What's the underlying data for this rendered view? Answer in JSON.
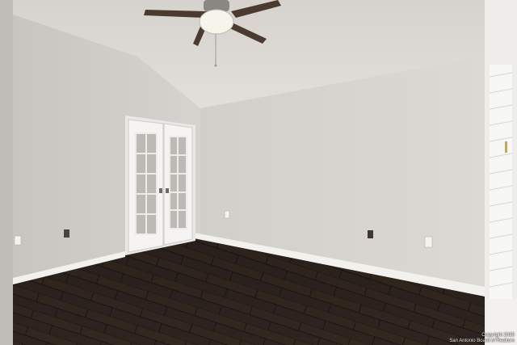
{
  "scene": {
    "kind": "photo",
    "room": "empty bedroom",
    "features": [
      "ceiling-fan",
      "french-doors",
      "dark-wood-plank-floor",
      "white-baseboards",
      "window-blinds",
      "vaulted-ceiling",
      "wall-outlets"
    ]
  },
  "watermark": {
    "line1": "Copyright 2025",
    "line2": "San Antonio Board of Realtors"
  },
  "colors": {
    "wall_left": "#cfccc7",
    "wall_back": "#d5d2cd",
    "ceiling": "#ddd9d4",
    "floor": "#2e231e",
    "baseboard": "#f2f1ee",
    "door": "#f4f3f1",
    "fan_blade": "#4a3a30"
  }
}
